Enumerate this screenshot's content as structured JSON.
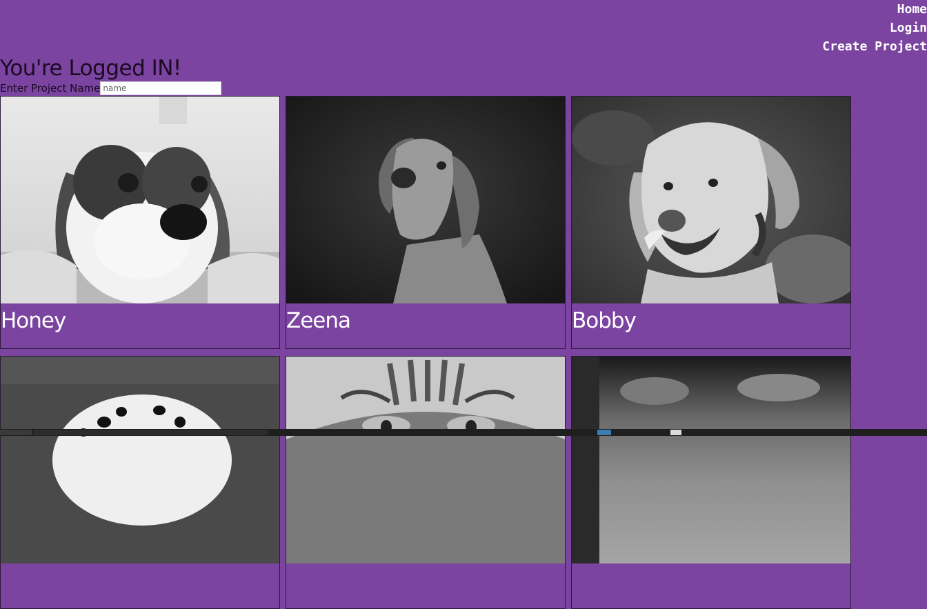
{
  "nav": {
    "home": "Home",
    "login": "Login",
    "create_project": "Create Project"
  },
  "page_title": "You're Logged IN!",
  "project_form": {
    "label": "Enter Project Name",
    "placeholder": "name"
  },
  "cards": [
    {
      "name": "Honey"
    },
    {
      "name": "Zeena"
    },
    {
      "name": "Bobby"
    },
    {
      "name": ""
    },
    {
      "name": ""
    },
    {
      "name": ""
    }
  ],
  "colors": {
    "background": "#7b44a0",
    "nav_text": "#ffffff",
    "title_text": "#1a0a22",
    "card_name": "#ffffff"
  }
}
